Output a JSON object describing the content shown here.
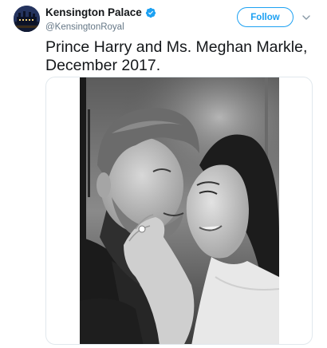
{
  "account": {
    "name": "Kensington Palace",
    "handle": "@KensingtonRoyal",
    "verified": true,
    "avatar_icon": "palace-avatar"
  },
  "actions": {
    "follow_label": "Follow",
    "menu_icon": "chevron-down-icon"
  },
  "tweet": {
    "text": "Prince Harry and Ms. Meghan Markle, December 2017."
  },
  "media": {
    "type": "photo",
    "style": "black-and-white",
    "subject": "couple-portrait"
  },
  "colors": {
    "accent": "#1da1f2",
    "text": "#14171a",
    "secondary_text": "#657786",
    "card_border": "#e1e8ed"
  }
}
